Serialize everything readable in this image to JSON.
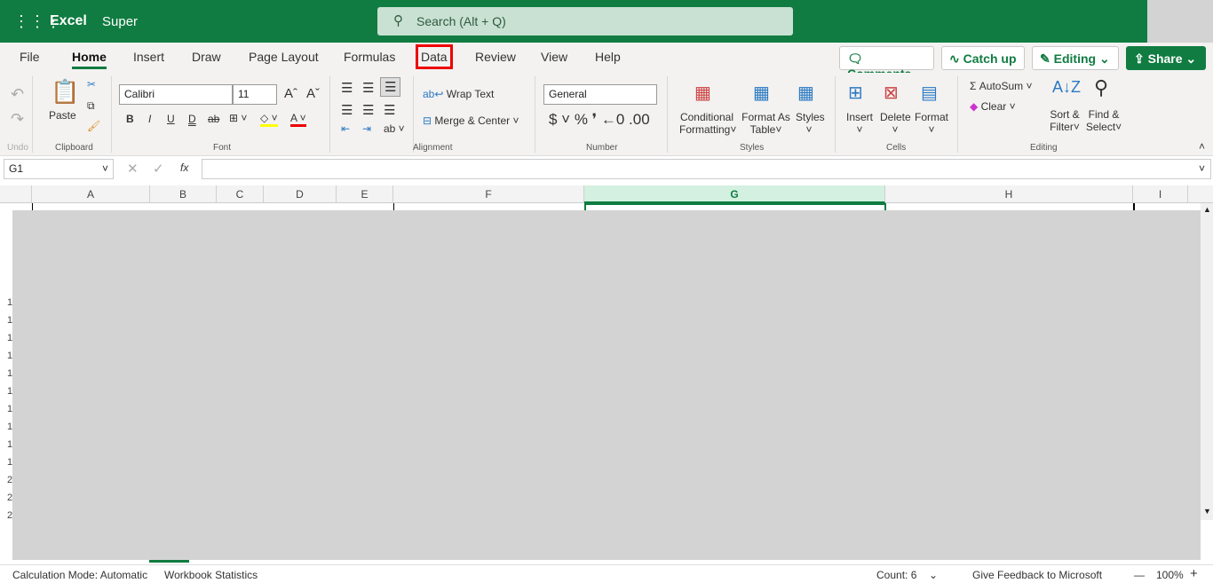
{
  "header": {
    "app": "Excel",
    "doc": "Super",
    "search_placeholder": "Search (Alt + Q)"
  },
  "tabs": [
    "File",
    "Home",
    "Insert",
    "Draw",
    "Page Layout",
    "Formulas",
    "Data",
    "Review",
    "View",
    "Help"
  ],
  "actions": {
    "comments": "Comments",
    "catchup": "Catch up",
    "editing": "Editing",
    "share": "Share"
  },
  "ribbon": {
    "undo": "Undo",
    "paste": "Paste",
    "clipboard": "Clipboard",
    "font_name": "Calibri",
    "font_size": "11",
    "font": "Font",
    "wrap": "Wrap Text",
    "merge": "Merge & Center",
    "alignment": "Alignment",
    "format": "General",
    "number": "Number",
    "cond": "Conditional",
    "cond2": "Formatting",
    "fat": "Format As",
    "fat2": "Table",
    "styles_btn": "Styles",
    "styles": "Styles",
    "insert": "Insert",
    "delete": "Delete",
    "format_btn": "Format",
    "cells": "Cells",
    "autosum": "AutoSum",
    "clear": "Clear",
    "sort": "Sort &",
    "sort2": "Filter",
    "find": "Find &",
    "find2": "Select",
    "editing": "Editing"
  },
  "formula": {
    "namebox": "G1",
    "fx": "fx",
    "value": ""
  },
  "columns": [
    "A",
    "B",
    "C",
    "D",
    "E",
    "F",
    "G",
    "H",
    "I"
  ],
  "selected_column": "G",
  "row_numbers": [
    "1",
    "1",
    "1",
    "1",
    "1",
    "1",
    "1",
    "1",
    "1",
    "1",
    "2",
    "2",
    "2"
  ],
  "status": {
    "calc": "Calculation Mode: Automatic",
    "stats": "Workbook Statistics",
    "count": "Count: 6",
    "feedback": "Give Feedback to Microsoft",
    "zoom": "100%"
  }
}
